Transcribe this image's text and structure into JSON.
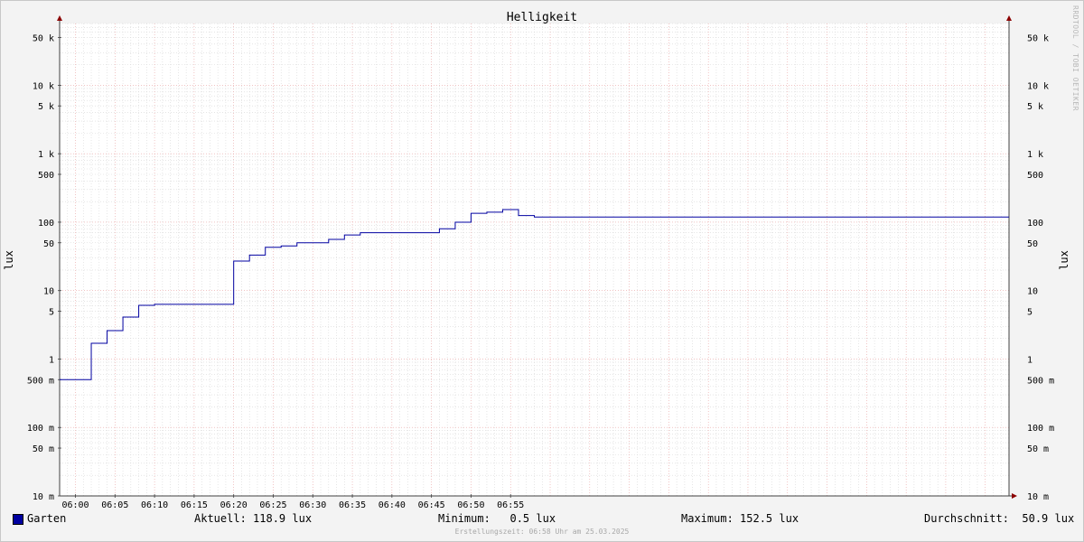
{
  "chart_data": {
    "type": "line",
    "title": "Helligkeit",
    "ylabel_left": "lux",
    "ylabel_right": "lux",
    "y_scale": "log",
    "ylim": [
      0.01,
      80000
    ],
    "y_tick_values": [
      0.01,
      0.05,
      0.1,
      0.5,
      1,
      5,
      10,
      50,
      100,
      500,
      1000,
      5000,
      10000,
      50000
    ],
    "y_tick_labels": [
      "10 m",
      "50 m",
      "100 m",
      "500 m",
      "1",
      "5",
      "10",
      "50",
      "100",
      "500",
      "1 k",
      "5 k",
      "10 k",
      "50 k"
    ],
    "x_tick_labels": [
      "06:00",
      "06:05",
      "06:10",
      "06:15",
      "06:20",
      "06:25",
      "06:30",
      "06:35",
      "06:40",
      "06:45",
      "06:50",
      "06:55"
    ],
    "x_range": [
      "05:58",
      "07:58"
    ],
    "grid": true,
    "series": [
      {
        "name": "Garten",
        "color": "#0000a0",
        "x": [
          "05:58",
          "06:02",
          "06:04",
          "06:06",
          "06:08",
          "06:10",
          "06:20",
          "06:22",
          "06:24",
          "06:26",
          "06:28",
          "06:32",
          "06:34",
          "06:36",
          "06:42",
          "06:46",
          "06:48",
          "06:50",
          "06:52",
          "06:54",
          "06:56",
          "06:58"
        ],
        "values": [
          0.5,
          1.7,
          2.6,
          4.1,
          6.1,
          6.3,
          27,
          33,
          43,
          45,
          50,
          56,
          65,
          70,
          70,
          80,
          100,
          135,
          140,
          152.5,
          125,
          118.9
        ]
      }
    ]
  },
  "legend": {
    "series_name": "Garten",
    "current": "Aktuell: 118.9 lux",
    "minimum": "Minimum:   0.5 lux",
    "maximum": "Maximum: 152.5 lux",
    "average": "Durchschnitt:  50.9 lux"
  },
  "footer": "Erstellungszeit: 06:58 Uhr am 25.03.2025",
  "watermark": "RRDTOOL / TOBI OETIKER"
}
